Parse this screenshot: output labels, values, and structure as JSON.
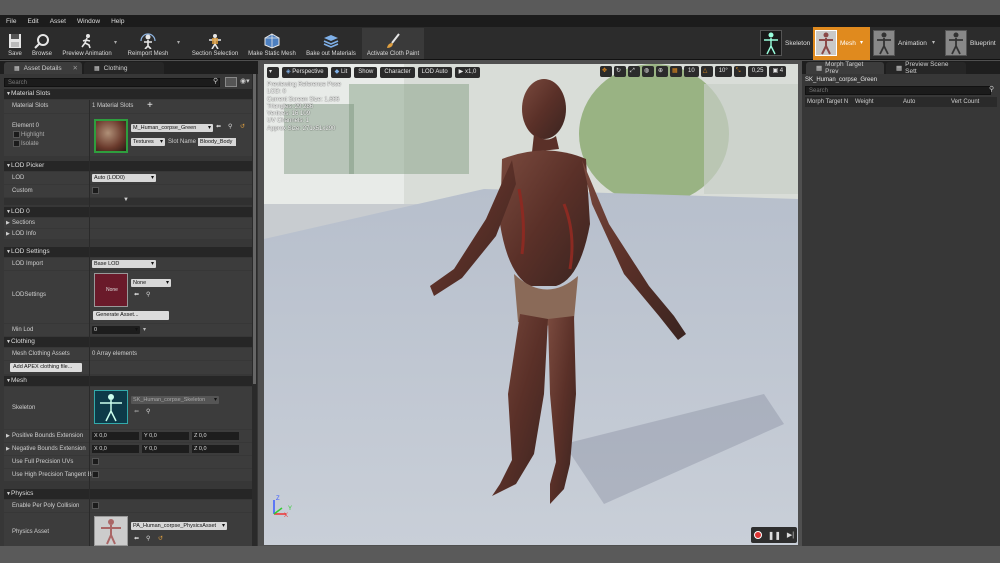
{
  "menu": [
    "File",
    "Edit",
    "Asset",
    "Window",
    "Help"
  ],
  "toolbar": {
    "save": "Save",
    "browse": "Browse",
    "preview_animation": "Preview Animation",
    "reimport_mesh": "Reimport Mesh",
    "section_selection": "Section Selection",
    "make_static_mesh": "Make Static Mesh",
    "bake_out_materials": "Bake out Materials",
    "activate_cloth_paint": "Activate Cloth Paint"
  },
  "modes": {
    "skeleton": "Skeleton",
    "mesh": "Mesh",
    "animation": "Animation",
    "blueprint": "Blueprint"
  },
  "left_tabs": {
    "asset_details": "Asset Details",
    "clothing": "Clothing"
  },
  "search_placeholder": "Search",
  "material_slots": {
    "header": "Material Slots",
    "label": "Material Slots",
    "count": "1 Material Slots",
    "element": "Element 0",
    "highlight": "Highlight",
    "isolate": "Isolate",
    "material": "M_Human_corpse_Green",
    "textures": "Textures",
    "slot_name_label": "Slot Name",
    "slot_name": "Bloody_Body"
  },
  "lod_picker": {
    "header": "LOD Picker",
    "lod_label": "LOD",
    "lod_value": "Auto (LOD0)",
    "custom": "Custom"
  },
  "lod0": {
    "header": "LOD 0",
    "sections": "Sections",
    "lod_info": "LOD Info"
  },
  "lod_settings": {
    "header": "LOD Settings",
    "lod_import": "LOD Import",
    "lod_import_value": "Base LOD",
    "lod_settings_label": "LODSettings",
    "thumb_text": "None",
    "none_value": "None",
    "generate_asset": "Generate Asset...",
    "min_lod": "Min Lod",
    "min_lod_value": "0"
  },
  "clothing": {
    "header": "Clothing",
    "mesh_clothing_assets": "Mesh Clothing Assets",
    "array_elements": "0 Array elements",
    "add_apex": "Add APEX clothing file..."
  },
  "mesh": {
    "header": "Mesh",
    "skeleton_label": "Skeleton",
    "skeleton_value": "SK_Human_corpse_Skeleton",
    "positive_bounds": "Positive Bounds Extension",
    "negative_bounds": "Negative Bounds Extension",
    "x_label": "X",
    "y_label": "Y",
    "z_label": "Z",
    "pos": [
      "0,0",
      "0,0",
      "0,0"
    ],
    "neg": [
      "0,0",
      "0,0",
      "0,0"
    ],
    "full_precision_uvs": "Use Full Precision UVs",
    "high_precision_tangent": "Use High Precision Tangent B"
  },
  "physics": {
    "header": "Physics",
    "enable_per_poly": "Enable Per Poly Collision",
    "physics_asset_label": "Physics Asset",
    "physics_asset_value": "PA_Human_corpse_PhysicsAsset"
  },
  "viewport": {
    "perspective": "Perspective",
    "lit": "Lit",
    "show": "Show",
    "character": "Character",
    "lod_auto": "LOD Auto",
    "speed": "x1,0",
    "grid_snap": "10",
    "rot_snap": "10°",
    "scale_snap": "0,25",
    "cam_speed": "4",
    "info": [
      "Previewing Reference Pose",
      "LOD: 0",
      "Current Screen Size: 1,666",
      "Triangles: 29 286",
      "Vertices: 16 109",
      "UV Channels: 1",
      "Approx Size: 271x51x290"
    ],
    "axis_x": "X",
    "axis_y": "Y",
    "axis_z": "Z"
  },
  "right_panel": {
    "tab_morph": "Morph Target Prev",
    "tab_scene": "Preview Scene Sett",
    "mesh_name": "SK_Human_corpse_Green",
    "search_placeholder": "Search",
    "columns": [
      "Morph Target N",
      "Weight",
      "Auto",
      "Vert Count"
    ]
  },
  "colors": {
    "accent": "#e08a1e",
    "panel": "#373737",
    "header": "#262626",
    "toolbar": "#2c2c2c"
  }
}
